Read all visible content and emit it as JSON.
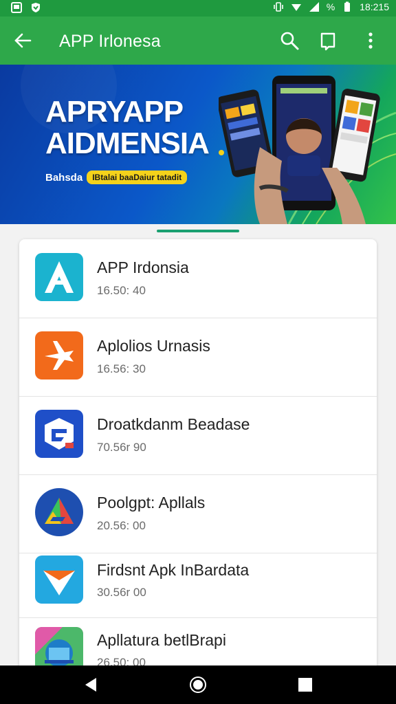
{
  "status_bar": {
    "time": "18:215",
    "battery": "%",
    "icons": [
      "gallery-icon",
      "shield-icon",
      "vibrate-icon",
      "wifi-icon",
      "signal-icon",
      "battery-icon"
    ]
  },
  "app_bar": {
    "title": "APP Irlonesa",
    "icons": [
      "back-arrow-icon",
      "search-icon",
      "bookmark-icon",
      "more-vert-icon"
    ]
  },
  "banner": {
    "headline_line1": "APRYAPP",
    "headline_line2": "AIDMENSIA",
    "tag_text": "Bahsda",
    "tag_pill": "IBtalai baaDaiur tatadit"
  },
  "apps": [
    {
      "name": "APP Irdonsia",
      "meta": "16.50: 40",
      "icon": "a-letter-icon",
      "color": "#1bb3cf"
    },
    {
      "name": "Aplolios Urnasis",
      "meta": "16.56: 30",
      "icon": "plane-icon",
      "color": "#f26a1b"
    },
    {
      "name": "Droatkdanm Beadase",
      "meta": "70.56r 90",
      "icon": "g-shield-icon",
      "color": "#1f4fc8"
    },
    {
      "name": "Poolgpt: Apllals",
      "meta": "20.56: 00",
      "icon": "triangle-icon",
      "color": "#1e4fb0"
    },
    {
      "name": "Firdsnt Apk InBardata",
      "meta": "30.56r 00",
      "icon": "chevron-shield-icon",
      "color": "#23a8e0"
    },
    {
      "name": "Apllatura betlBrapi",
      "meta": "26.50: 00",
      "icon": "laptop-icon",
      "color": "#e05aa8"
    }
  ],
  "nav": {
    "icons": [
      "nav-back-icon",
      "nav-home-icon",
      "nav-recent-icon"
    ]
  }
}
